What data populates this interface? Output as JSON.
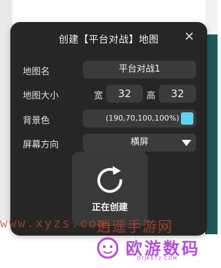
{
  "dialog": {
    "title": "创建【平台对战】地图",
    "close_label": "✕",
    "map_name": {
      "label": "地图名",
      "value": "平台对战1"
    },
    "map_size": {
      "label": "地图大小",
      "width_label": "宽",
      "width": "32",
      "height_label": "高",
      "height": "32"
    },
    "background_color": {
      "label": "背景色",
      "value": "(190,70,100,100%)",
      "swatch": "#5fd3f2"
    },
    "orientation": {
      "label": "屏幕方向",
      "value": "横屏"
    }
  },
  "loading": {
    "text": "正在创建"
  },
  "watermark": {
    "url": "www.xyzs.com",
    "site_name": "逍遥手游网"
  },
  "brand": {
    "name": "欧游数码",
    "domain": "OYJK672.COM",
    "color": "#b34fd1"
  }
}
